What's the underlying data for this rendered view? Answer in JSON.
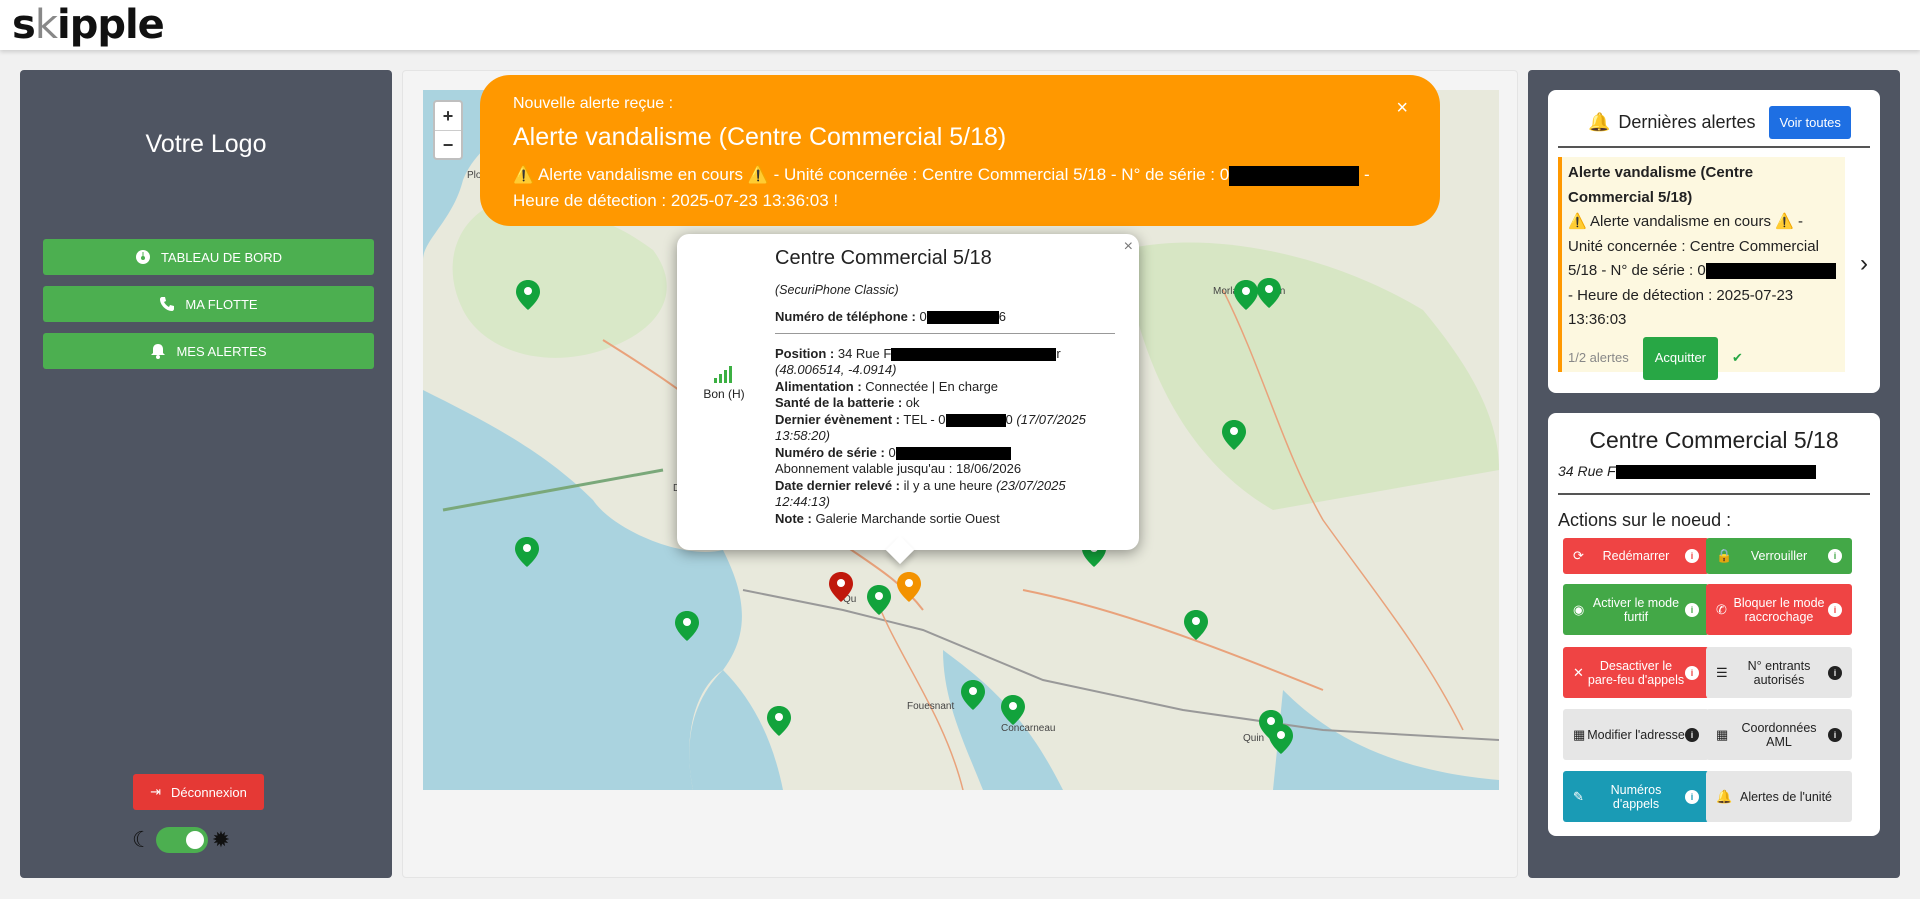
{
  "app": {
    "logo_left": "s",
    "logo_mid": "k",
    "logo_right": "ipple"
  },
  "sidebar": {
    "brand": "Votre Logo",
    "items": [
      {
        "label": "TABLEAU DE BORD",
        "icon": "dashboard-icon"
      },
      {
        "label": "MA FLOTTE",
        "icon": "phone-icon"
      },
      {
        "label": "MES ALERTES",
        "icon": "bell-icon"
      }
    ],
    "logout": "Déconnexion",
    "theme_dark_icon": "moon-icon",
    "theme_light_icon": "gear-sun-icon",
    "theme_toggle_on": true
  },
  "map": {
    "zoom_in": "+",
    "zoom_out": "−",
    "labels": [
      "Plo",
      "Morlaix-Plougon",
      "D",
      "Qu",
      "Fouesnant",
      "Concarneau",
      "Quin"
    ]
  },
  "alert_banner": {
    "heading": "Nouvelle alerte reçue :",
    "title": "Alerte vandalisme (Centre Commercial 5/18)",
    "msg_a": "⚠️ Alerte vandalisme en cours ⚠️ - Unité concernée : Centre Commercial 5/18 - N° de série : 0",
    "msg_b": " - Heure de détection : 2025-07-23 13:36:03 !",
    "close": "×",
    "color": "#ff9800"
  },
  "popup": {
    "title": "Centre Commercial 5/18",
    "model": "(SecuriPhone Classic)",
    "phone_label": "Numéro de téléphone :",
    "phone_a": "0",
    "phone_b": "6",
    "position_label": "Position :",
    "position_a": "34 Rue F",
    "position_b": "r",
    "coords": "(48.006514, -4.0914)",
    "power_label": "Alimentation :",
    "power": "Connectée | En charge",
    "battery_label": "Santé de la batterie :",
    "battery": "ok",
    "event_label": "Dernier évènement :",
    "event_a": "TEL - 0",
    "event_b": "0",
    "event_date": "(17/07/2025 13:58:20)",
    "serial_label": "Numéro de série :",
    "serial_a": "0",
    "subscription": "Abonnement valable jusqu'au : 18/06/2026",
    "last_label": "Date dernier relevé :",
    "last": "il y a une heure",
    "last_date": "(23/07/2025 12:44:13)",
    "note_label": "Note :",
    "note": "Galerie Marchande sortie Ouest",
    "signal": "Bon (H)",
    "close": "×"
  },
  "latest_alerts": {
    "title": "Dernières alertes",
    "see_all": "Voir toutes",
    "alert_title": "Alerte vandalisme (Centre Commercial 5/18)",
    "alert_a": "⚠️ Alerte vandalisme en cours ⚠️ - Unité concernée : Centre Commercial 5/18 - N° de série : 0",
    "alert_b": " - Heure de détection : 2025-07-23 13:36:03",
    "counter": "1/2 alertes",
    "ack": "Acquitter",
    "next_icon": "chevron-right-icon"
  },
  "node": {
    "title": "Centre Commercial 5/18",
    "address_a": "34 Rue F",
    "actions_title": "Actions sur le noeud :",
    "actions": [
      {
        "label": "Redémarrer",
        "icon": "refresh-icon",
        "color": "#ef4444"
      },
      {
        "label": "Verrouiller",
        "icon": "lock-icon",
        "color": "#43a847"
      },
      {
        "label": "Activer le mode furtif",
        "icon": "eye-slash-icon",
        "color": "#43a847"
      },
      {
        "label": "Bloquer le mode raccrochage",
        "icon": "phone-slash-icon",
        "color": "#ef4444"
      },
      {
        "label": "Desactiver le pare-feu d'appels",
        "icon": "x-icon",
        "color": "#ef4444"
      },
      {
        "label": "N° entrants autorisés",
        "icon": "list-check-icon",
        "color": "#e6e6e6"
      },
      {
        "label": "Modifier l'adresse",
        "icon": "map-marked-icon",
        "color": "#e6e6e6"
      },
      {
        "label": "Coordonnées AML",
        "icon": "map-marked-icon",
        "color": "#e6e6e6"
      },
      {
        "label": "Numéros d'appels",
        "icon": "pencil-icon",
        "color": "#1a9bb5"
      },
      {
        "label": "Alertes de l'unité",
        "icon": "bell-icon",
        "color": "#e6e6e6"
      }
    ]
  }
}
